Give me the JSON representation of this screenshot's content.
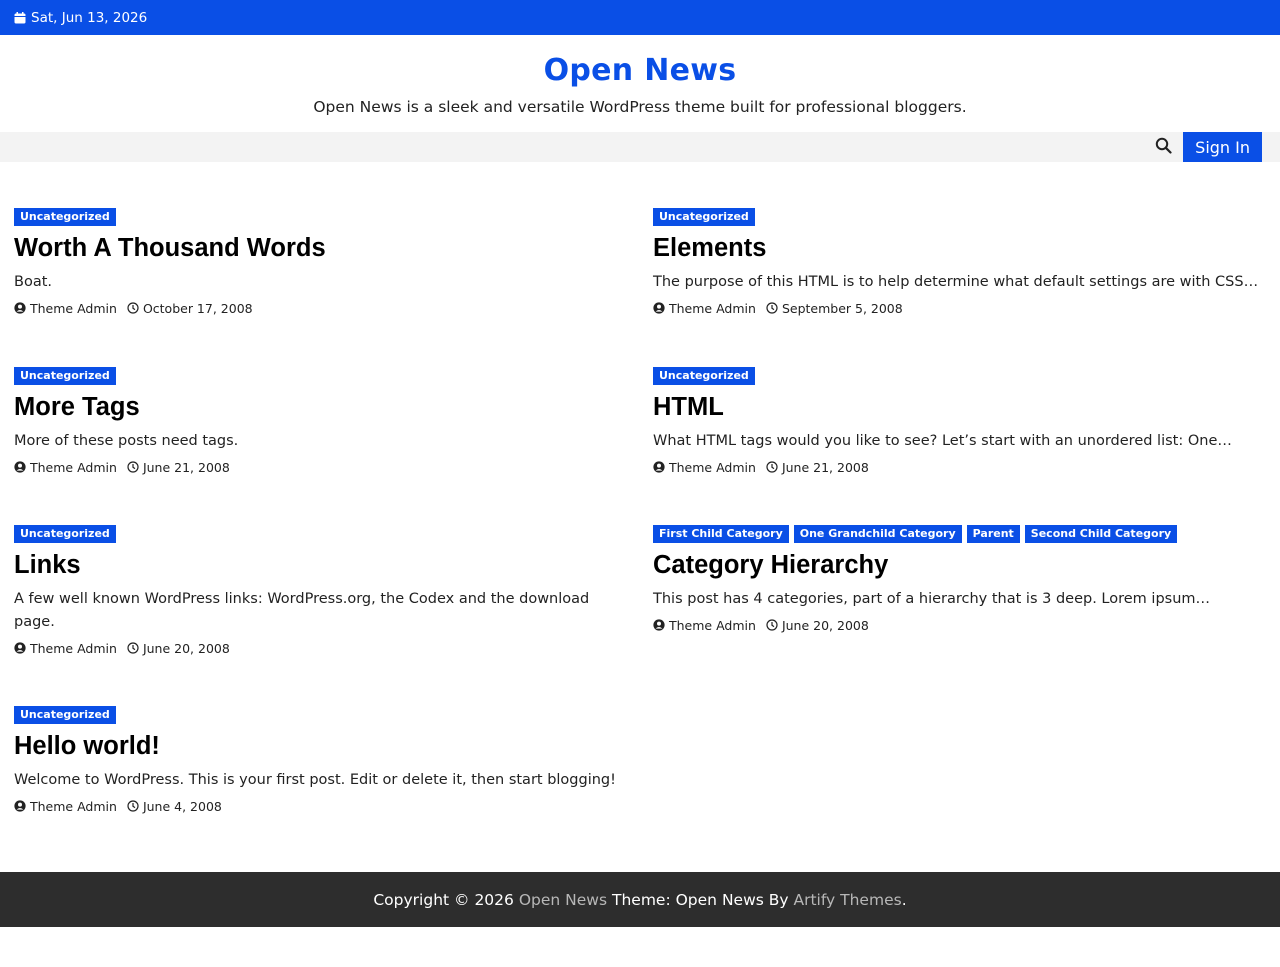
{
  "topbar": {
    "date": "Sat, Jun 13, 2026",
    "icon": "calendar-icon"
  },
  "brand": {
    "title": "Open News",
    "tagline": "Open News is a sleek and versatile WordPress theme built for professional bloggers."
  },
  "nav": {
    "search_icon": "search-icon",
    "signin_label": "Sign In"
  },
  "posts": [
    {
      "categories": [
        "Uncategorized"
      ],
      "title": "Worth A Thousand Words",
      "excerpt": "Boat.",
      "author": "Theme Admin",
      "date": "October 17, 2008"
    },
    {
      "categories": [
        "Uncategorized"
      ],
      "title": "Elements",
      "excerpt": "The purpose of this HTML is to help determine what default settings are with CSS…",
      "author": "Theme Admin",
      "date": "September 5, 2008"
    },
    {
      "categories": [
        "Uncategorized"
      ],
      "title": "More Tags",
      "excerpt": "More of these posts need tags.",
      "author": "Theme Admin",
      "date": "June 21, 2008"
    },
    {
      "categories": [
        "Uncategorized"
      ],
      "title": "HTML",
      "excerpt": "What HTML tags would you like to see? Let’s start with an unordered list: One…",
      "author": "Theme Admin",
      "date": "June 21, 2008"
    },
    {
      "categories": [
        "Uncategorized"
      ],
      "title": "Links",
      "excerpt": "A few well known WordPress links: WordPress.org, the Codex and the download page.",
      "author": "Theme Admin",
      "date": "June 20, 2008"
    },
    {
      "categories": [
        "First Child Category",
        "One Grandchild Category",
        "Parent",
        "Second Child Category"
      ],
      "title": "Category Hierarchy",
      "excerpt": "This post has 4 categories, part of a hierarchy that is 3 deep. Lorem ipsum…",
      "author": "Theme Admin",
      "date": "June 20, 2008"
    },
    {
      "categories": [
        "Uncategorized"
      ],
      "title": "Hello world!",
      "excerpt": "Welcome to WordPress. This is your first post. Edit or delete it, then start blogging!",
      "author": "Theme Admin",
      "date": "June 4, 2008"
    }
  ],
  "footer": {
    "copyright": "Copyright © 2026",
    "site_link": "Open News",
    "theme_text": "Theme: Open News By",
    "author_link": "Artify Themes",
    "period": "."
  },
  "colors": {
    "accent": "#0a4fe6",
    "footer_bg": "#2d2d2d",
    "nav_bg": "#f3f3f3"
  }
}
